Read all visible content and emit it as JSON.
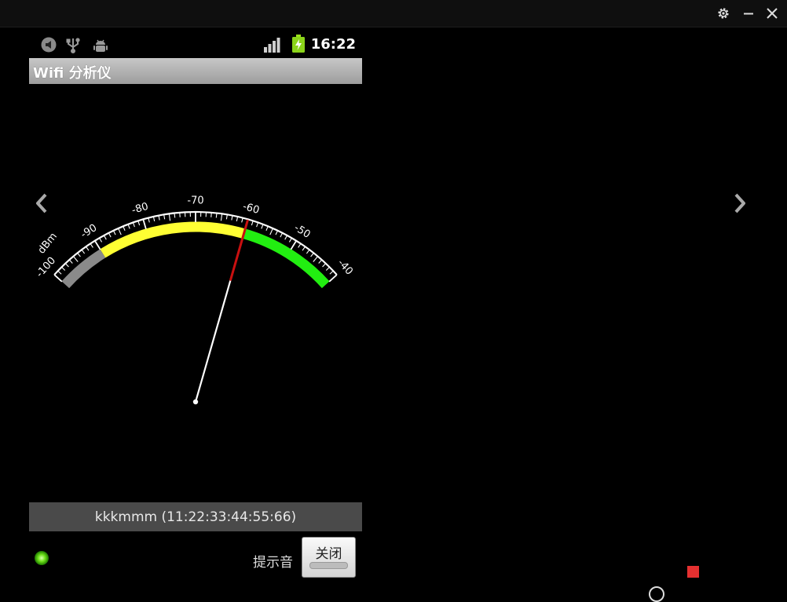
{
  "window": {
    "settings_icon": "gear-icon",
    "minimize_icon": "minimize-icon",
    "close_icon": "close-icon"
  },
  "status_bar": {
    "left_icons": [
      "media-icon",
      "usb-icon",
      "android-debug-icon"
    ],
    "signal_icon": "signal-bars-icon",
    "battery_icon": "battery-charging-icon",
    "time": "16:22"
  },
  "app": {
    "title": "Wifi 分析仪"
  },
  "navigation": {
    "prev_icon": "chevron-left-icon",
    "next_icon": "chevron-right-icon"
  },
  "gauge": {
    "unit": "dBm",
    "min": -100,
    "max": -40,
    "tick_labels": [
      "-100",
      "-90",
      "-80",
      "-70",
      "-60",
      "-50",
      "-40"
    ],
    "zones": [
      {
        "from": -100,
        "to": -90,
        "color": "#8a8a8a"
      },
      {
        "from": -90,
        "to": -60,
        "color": "#ffff33"
      },
      {
        "from": -60,
        "to": -40,
        "color": "#22ee11"
      }
    ],
    "needle_value": -60,
    "needle_color": "#ffffff",
    "needle_tip_color": "#c81010"
  },
  "network": {
    "label": "kkkmmm (11:22:33:44:55:66)"
  },
  "controls": {
    "sound_label": "提示音",
    "close_label": "关闭",
    "led_color": "#6ee11a"
  },
  "overlay": {
    "record_icon": "record-stop-icon",
    "record_color": "#e53030"
  }
}
